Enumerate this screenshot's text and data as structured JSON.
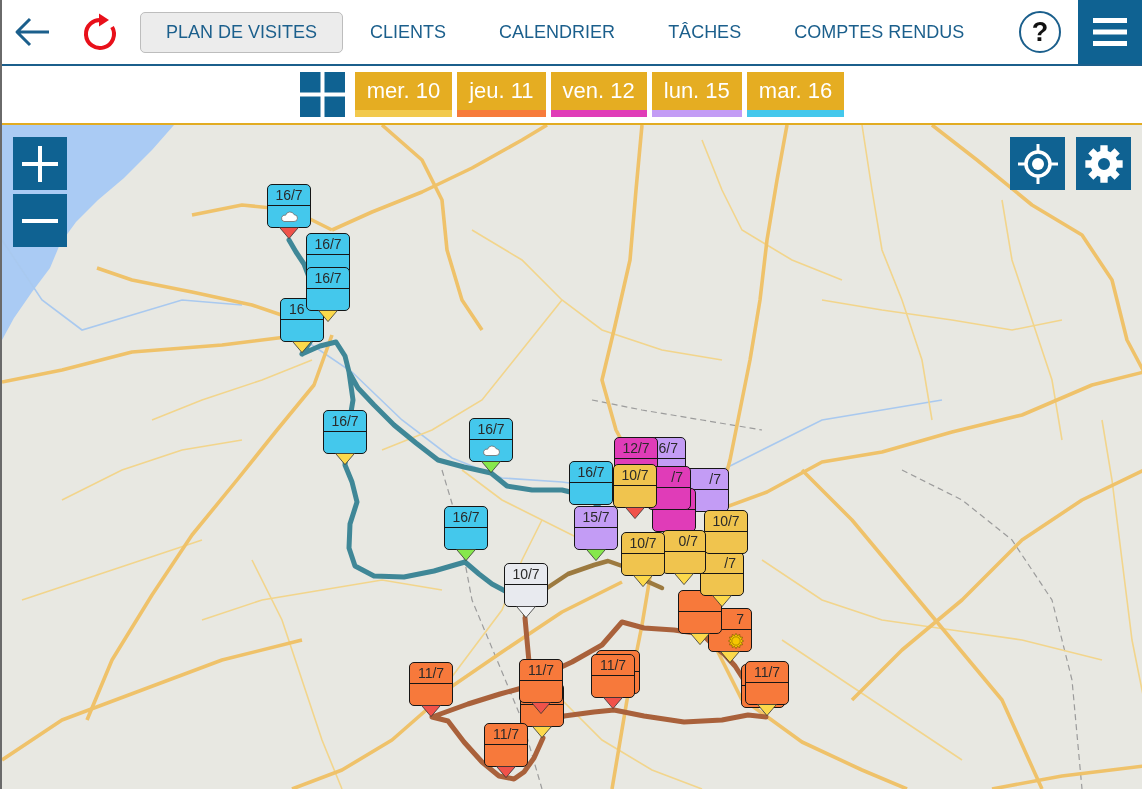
{
  "toolbar": {
    "tabs": [
      {
        "label": "PLAN DE VISITES",
        "selected": true
      },
      {
        "label": "CLIENTS",
        "selected": false
      },
      {
        "label": "CALENDRIER",
        "selected": false
      },
      {
        "label": "TÂCHES",
        "selected": false
      },
      {
        "label": "COMPTES RENDUS",
        "selected": false
      }
    ],
    "help": "?"
  },
  "day_filter": {
    "days": [
      {
        "label": "mer. 10",
        "color": "#f2c94c",
        "selected": true
      },
      {
        "label": "jeu. 11",
        "color": "#f77b3b",
        "selected": true
      },
      {
        "label": "ven. 12",
        "color": "#e03cb8",
        "selected": true
      },
      {
        "label": "lun. 15",
        "color": "#c39cf5",
        "selected": true
      },
      {
        "label": "mar. 16",
        "color": "#44c8ec",
        "selected": true
      }
    ]
  },
  "map": {
    "markers": [
      {
        "label": "16/7",
        "color": "#44c8ec",
        "kind": "cloudy",
        "pin": {
          "color": "#f0524a"
        }
      },
      {
        "label": "16/7",
        "color": "#44c8ec",
        "kind": "plain"
      },
      {
        "label": "16/7",
        "color": "#44c8ec",
        "kind": "plain",
        "pin": {
          "color": "#fcd94b"
        }
      },
      {
        "label": "16",
        "color": "#44c8ec",
        "kind": "plain",
        "pin": {
          "color": "#fcd94b"
        }
      },
      {
        "label": "16/7",
        "color": "#44c8ec",
        "kind": "plain",
        "pin": {
          "color": "#fcd94b"
        }
      },
      {
        "label": "16/7",
        "color": "#44c8ec",
        "kind": "cloudy",
        "pin": {
          "color": "#86e84c"
        }
      },
      {
        "label": "12/7",
        "color": "#e03cb8",
        "kind": "plain"
      },
      {
        "label": "6/7",
        "color": "#c39cf5",
        "kind": "plain"
      },
      {
        "label": "16/7",
        "color": "#44c8ec",
        "kind": "plain"
      },
      {
        "label": "10/7",
        "color": "#f0c44e",
        "kind": "plain",
        "pin": {
          "color": "#f0524a"
        }
      },
      {
        "label": "/7",
        "color": "#e03cb8",
        "kind": "plain"
      },
      {
        "label": "/7",
        "color": "#c39cf5",
        "kind": "plain"
      },
      {
        "color": "#e03cb8",
        "kind": "plain"
      },
      {
        "label": "16/7",
        "color": "#44c8ec",
        "kind": "plain",
        "pin": {
          "color": "#86e84c"
        }
      },
      {
        "label": "15/7",
        "color": "#c39cf5",
        "kind": "plain",
        "pin": {
          "color": "#86e84c"
        }
      },
      {
        "label": "10/7",
        "color": "#f0c44e",
        "kind": "plain"
      },
      {
        "label": "10/7",
        "color": "#f0c44e",
        "kind": "plain",
        "pin": {
          "color": "#fcd94b"
        }
      },
      {
        "label": "0/7",
        "color": "#f0c44e",
        "kind": "plain",
        "pin": {
          "color": "#fcd94b"
        }
      },
      {
        "label": "10/7",
        "color": "#e8eaef",
        "kind": "plain",
        "pin": {
          "color": "#f2f4f6"
        }
      },
      {
        "label": "/7",
        "color": "#f0c44e",
        "kind": "plain",
        "pin": {
          "color": "#fcd94b"
        }
      },
      {
        "color": "#f7793b",
        "kind": "plain",
        "pin": {
          "color": "#fcd94b"
        }
      },
      {
        "label": "7",
        "color": "#f7793b",
        "kind": "sunny",
        "pin": {
          "color": "#fcd94b"
        }
      },
      {
        "label": "11/7",
        "color": "#f7793b",
        "kind": "plain",
        "pin": {
          "color": "#f0524a"
        }
      },
      {
        "label": "11/7",
        "color": "#f7793b",
        "kind": "plain",
        "pin": {
          "color": "#f0524a"
        }
      },
      {
        "label": "11/7",
        "color": "#f7793b",
        "kind": "plain",
        "pin": {
          "color": "#f0524a"
        }
      },
      {
        "color": "#f7793b",
        "kind": "plain"
      },
      {
        "color": "#f7793b",
        "kind": "plain"
      },
      {
        "label": "11/7",
        "color": "#f7793b",
        "kind": "plain",
        "pin": {
          "color": "#fcd94b"
        }
      },
      {
        "color": "#f7793b",
        "kind": "plain",
        "pin": {
          "color": "#fcd94b"
        }
      },
      {
        "label": "11/7",
        "color": "#f7793b",
        "kind": "plain",
        "pin": {
          "color": "#f0524a"
        }
      }
    ]
  }
}
